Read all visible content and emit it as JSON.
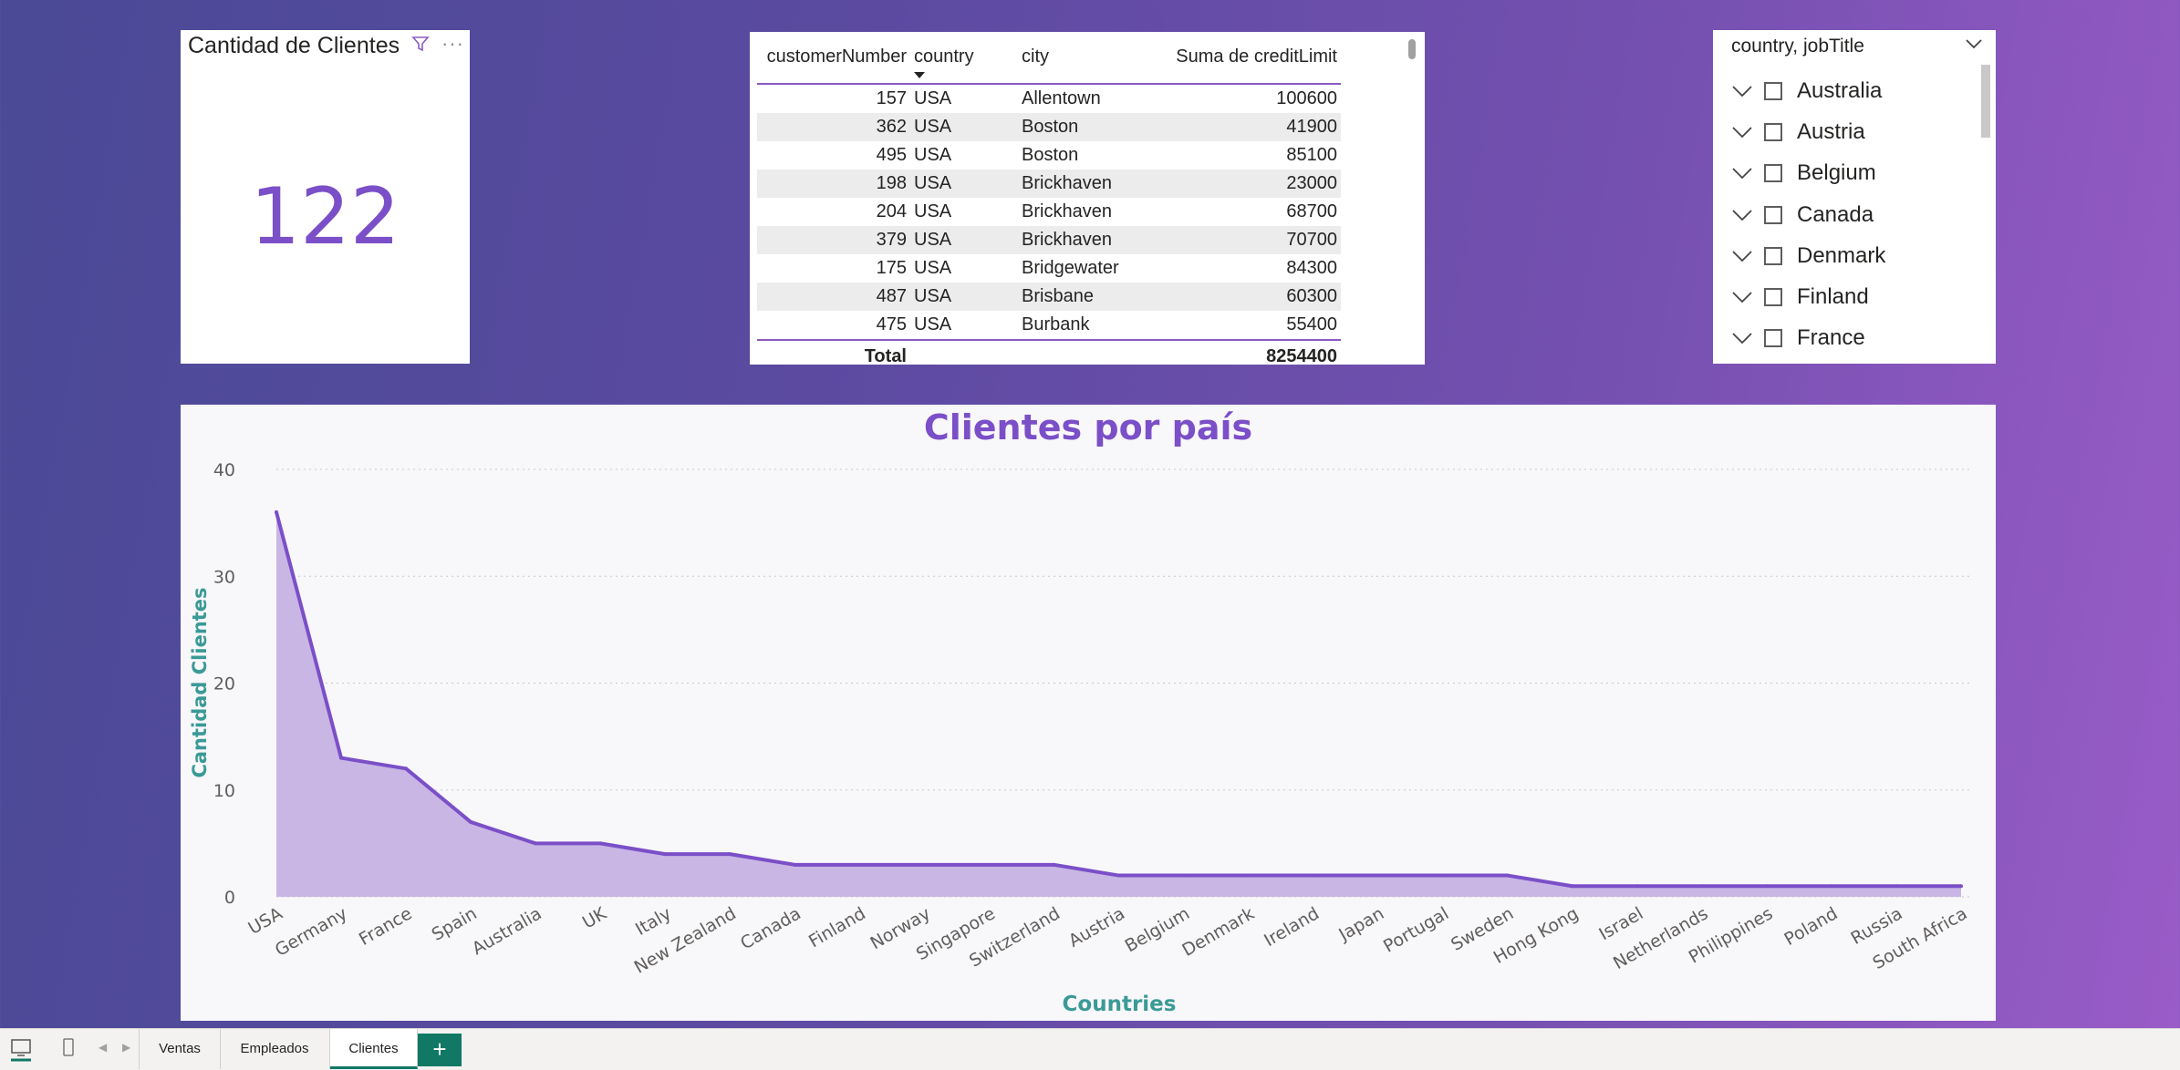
{
  "kpi": {
    "title": "Cantidad de Clientes",
    "value": "122",
    "filter_icon": "filter-icon",
    "more_icon": "more-options-icon",
    "more_label": "···"
  },
  "table": {
    "headers": [
      "customerNumber",
      "country",
      "city",
      "Suma de creditLimit"
    ],
    "rows": [
      [
        "157",
        "USA",
        "Allentown",
        "100600"
      ],
      [
        "362",
        "USA",
        "Boston",
        "41900"
      ],
      [
        "495",
        "USA",
        "Boston",
        "85100"
      ],
      [
        "198",
        "USA",
        "Brickhaven",
        "23000"
      ],
      [
        "204",
        "USA",
        "Brickhaven",
        "68700"
      ],
      [
        "379",
        "USA",
        "Brickhaven",
        "70700"
      ],
      [
        "175",
        "USA",
        "Bridgewater",
        "84300"
      ],
      [
        "487",
        "USA",
        "Brisbane",
        "60300"
      ],
      [
        "475",
        "USA",
        "Burbank",
        "55400"
      ]
    ],
    "total_label": "Total",
    "total_value": "8254400"
  },
  "slicer": {
    "title": "country, jobTitle",
    "items": [
      "Australia",
      "Austria",
      "Belgium",
      "Canada",
      "Denmark",
      "Finland",
      "France"
    ]
  },
  "chart_data": {
    "type": "area",
    "title": "Clientes por país",
    "xlabel": "Countries",
    "ylabel": "Cantidad Clientes",
    "ylim": [
      0,
      40
    ],
    "yticks": [
      0,
      10,
      20,
      30,
      40
    ],
    "categories": [
      "USA",
      "Germany",
      "France",
      "Spain",
      "Australia",
      "UK",
      "Italy",
      "New Zealand",
      "Canada",
      "Finland",
      "Norway",
      "Singapore",
      "Switzerland",
      "Austria",
      "Belgium",
      "Denmark",
      "Ireland",
      "Japan",
      "Portugal",
      "Sweden",
      "Hong Kong",
      "Israel",
      "Netherlands",
      "Philippines",
      "Poland",
      "Russia",
      "South Africa"
    ],
    "values": [
      36,
      13,
      12,
      7,
      5,
      5,
      4,
      4,
      3,
      3,
      3,
      3,
      3,
      2,
      2,
      2,
      2,
      2,
      2,
      2,
      1,
      1,
      1,
      1,
      1,
      1,
      1
    ],
    "line_color": "#7b4fc8",
    "fill_color": "#c9b6e4",
    "title_color": "#7b4fc8",
    "axis_label_color": "#3a9a96",
    "grid": true
  },
  "statusbar": {
    "tabs": [
      "Ventas",
      "Empleados",
      "Clientes"
    ],
    "active_tab": "Clientes",
    "add_label": "+",
    "accent": "#117865"
  }
}
